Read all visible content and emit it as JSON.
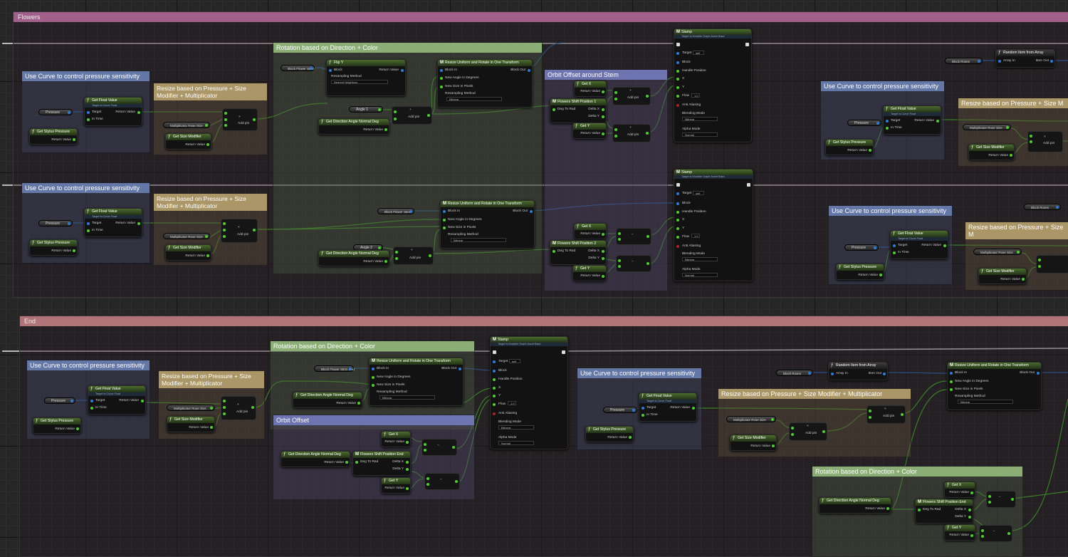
{
  "groups": {
    "flowers": "Flowers",
    "end": "End"
  },
  "comments": {
    "use_curve": "Use Curve to control pressure sensitivity",
    "resize": "Resize based on Pressure + Size Modifier + Multiplicator",
    "resize_short": "Resize based on Pressure + Size M",
    "resize_tiny": "Resize based on Pressure + Size Modifier + Multiplicator",
    "rotation": "Rotation based on Direction + Color",
    "orbit_stem": "Orbit Offset around Stem",
    "orbit": "Orbit Offset"
  },
  "nodes": {
    "get_float_value": "Get Float Value",
    "target_curve": "Target is Curve Float",
    "pressure": "Pressure",
    "get_stylus_pressure": "Get Stylus Pressure",
    "return_value": "Return Value",
    "target": "Target",
    "in_time": "In Time",
    "multiplicator_rose_size": "Multiplicator Rose Size",
    "get_size_modifier": "Get Size Modifier",
    "add_pin": "Add pin",
    "angle1": "Angle 1",
    "angle2": "Angle 2",
    "get_direction_angle": "Get Direction Angle Normal Deg",
    "block_flower_stem": "Block Flower Stem",
    "block_flower_stem_end": "Block Flower Stem End",
    "flip_y": "Flip Y",
    "block": "Block",
    "resampling_method": "Resampling Method",
    "nearest_neighbour": "Nearest Neighbour",
    "bilinear": "Bilinear",
    "resize_uniform": "Resize Uniform and Rotate in One Transform",
    "block_in": "Block In",
    "block_out": "Block Out",
    "new_angle": "New Angle in Degrees",
    "new_size": "New Size in Pixels",
    "get_x": "Get X",
    "get_y": "Get Y",
    "flowers_shift_1": "Flowers Shift Position 1",
    "flowers_shift_2": "Flowers Shift Position 2",
    "flowers_shift_end": "Flowers Shift Position End",
    "deg_to_rad": "Deg To Rad",
    "delta_x": "Delta X",
    "delta_y": "Delta Y",
    "stamp": "Stamp",
    "stamp_target": "Target is Mutable Graph Asset Base",
    "self": "self",
    "handle_position": "Handle Position",
    "x": "X",
    "y": "Y",
    "flow": "Flow",
    "flow_value": "1.0",
    "anti_aliasing": "Anti Aliasing",
    "blending_mode": "Blending Mode",
    "alpha_mode": "Alpha Mode",
    "normal": "Normal",
    "random_item": "Random Item from Array",
    "block_roses": "Block Roses",
    "array_in": "Array In",
    "item_out": "Item Out"
  }
}
